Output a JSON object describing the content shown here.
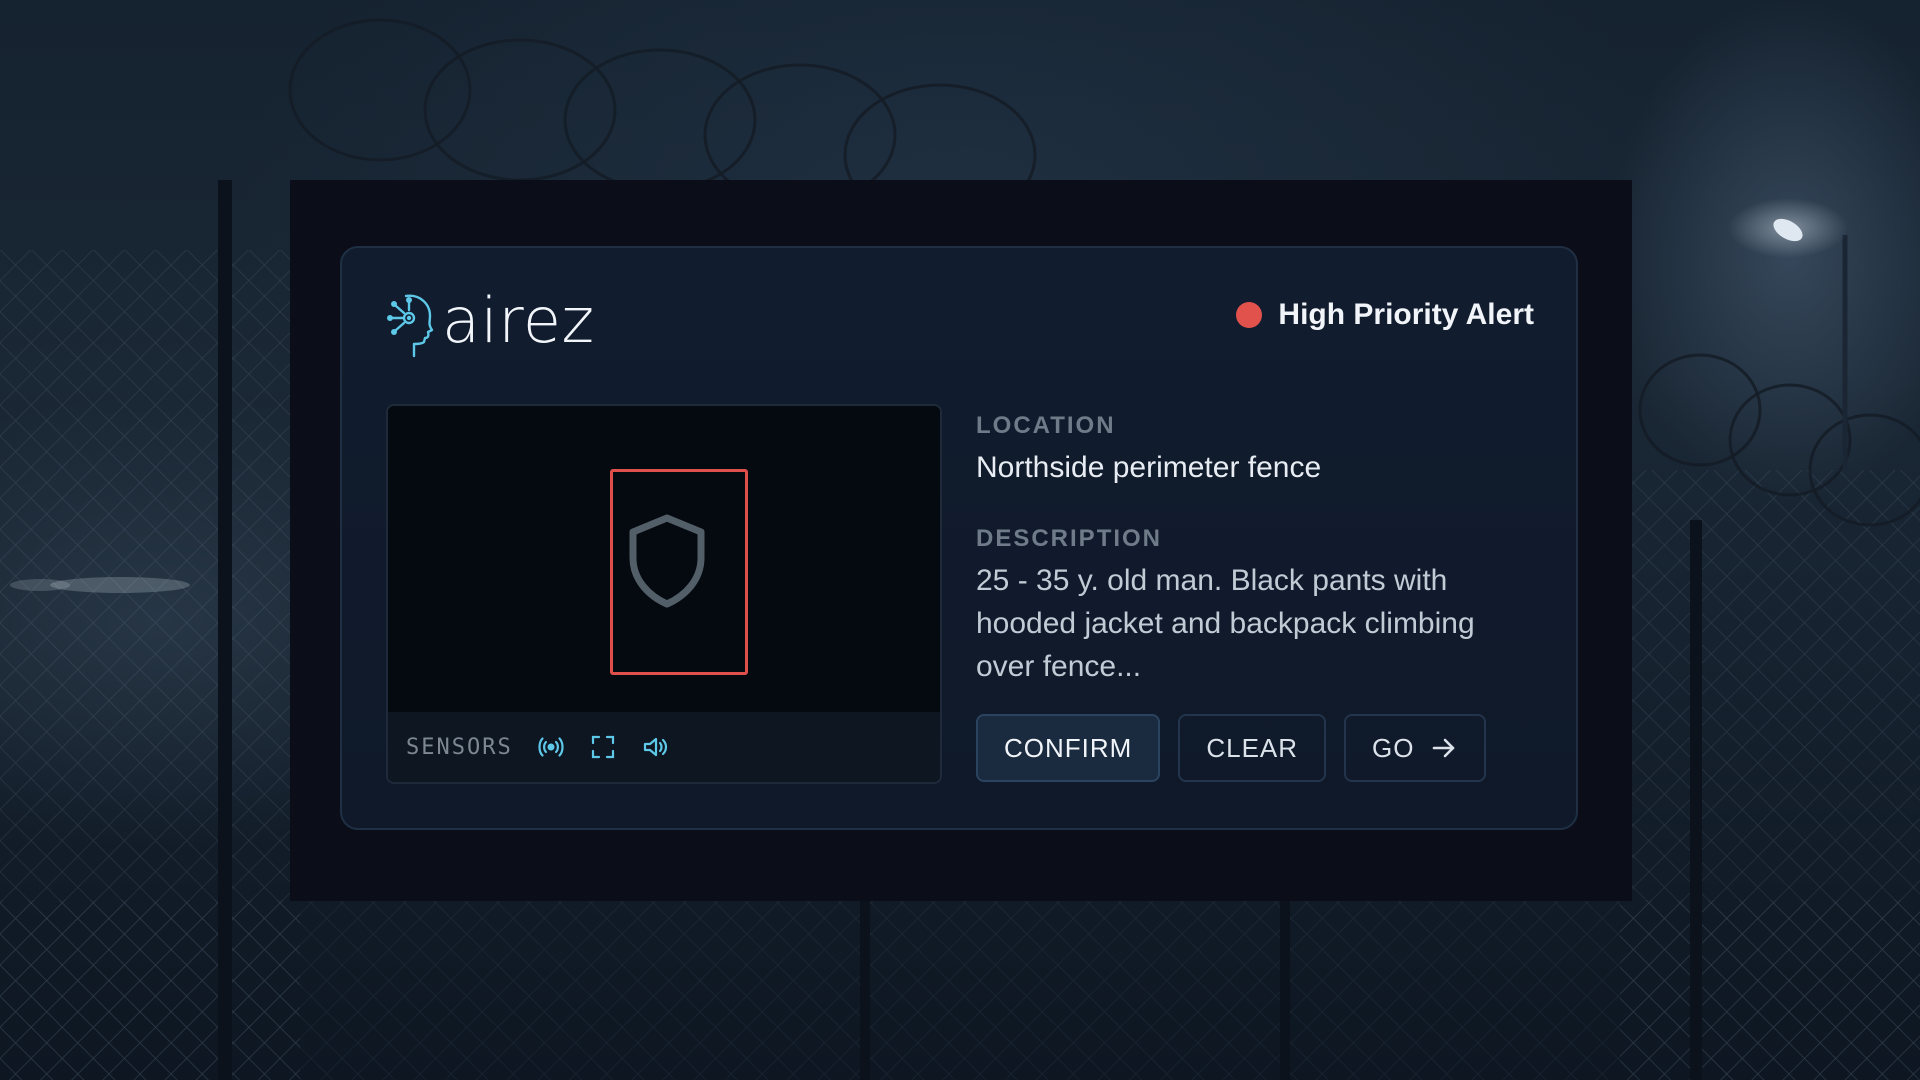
{
  "brand": {
    "name": "airez",
    "mark_icon": "ai-head-icon",
    "accent": "#5ec8e8"
  },
  "alert": {
    "label": "High Priority Alert",
    "indicator_color": "#e2524d"
  },
  "preview": {
    "detection_color": "#e0504b",
    "placeholder_icon": "shield-icon",
    "sensors_label": "SENSORS",
    "sensor_icons": [
      "broadcast-icon",
      "scan-frame-icon",
      "speaker-icon"
    ]
  },
  "details": {
    "location_label": "LOCATION",
    "location_value": "Northside perimeter fence",
    "description_label": "DESCRIPTION",
    "description_value": "25 - 35 y. old man. Black pants with hooded jacket and backpack climbing over fence..."
  },
  "actions": {
    "confirm_label": "CONFIRM",
    "clear_label": "CLEAR",
    "go_label": "GO",
    "go_icon": "arrow-right-icon"
  },
  "colors": {
    "card_bg": "#111c2e",
    "backdrop": "#0b0d19",
    "sensor_icon": "#5ec8e8"
  }
}
